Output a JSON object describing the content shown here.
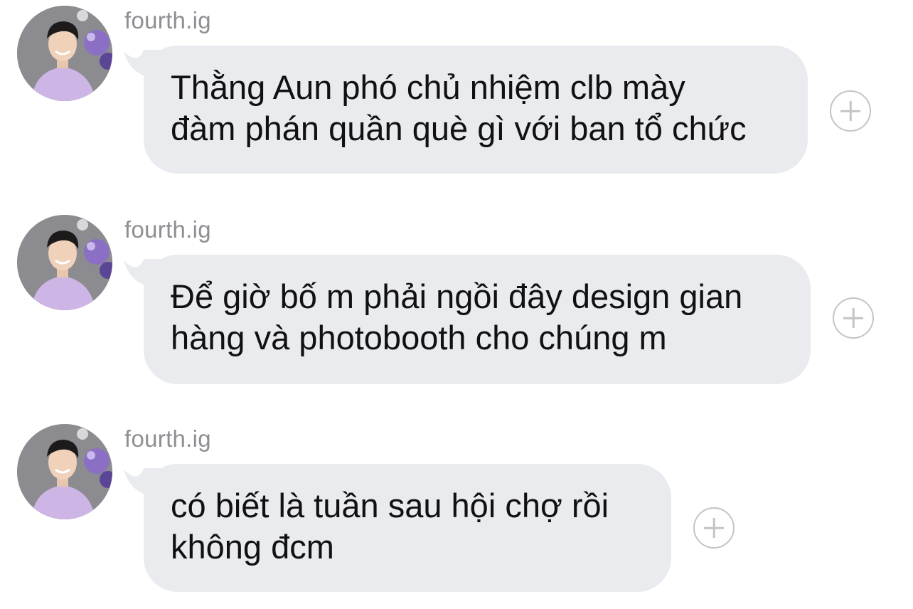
{
  "messages": [
    {
      "sender": "fourth.ig",
      "text": "Thằng Aun phó chủ nhiệm clb mày\nđàm phán quần què gì với ban tổ chức",
      "avatar_icon": "profile-photo",
      "reaction_icon": "add-reaction-icon"
    },
    {
      "sender": "fourth.ig",
      "text": "Để giờ bố m phải ngồi đây design gian\nhàng và photobooth cho chúng m",
      "avatar_icon": "profile-photo",
      "reaction_icon": "add-reaction-icon"
    },
    {
      "sender": "fourth.ig",
      "text": "có biết là tuần sau hội chợ rồi\nkhông đcm",
      "avatar_icon": "profile-photo",
      "reaction_icon": "add-reaction-icon"
    }
  ],
  "colors": {
    "bubble": "#e9ebee",
    "sender_text": "#8e8e93",
    "message_text": "#111111",
    "react_icon": "#c4c4c8"
  }
}
